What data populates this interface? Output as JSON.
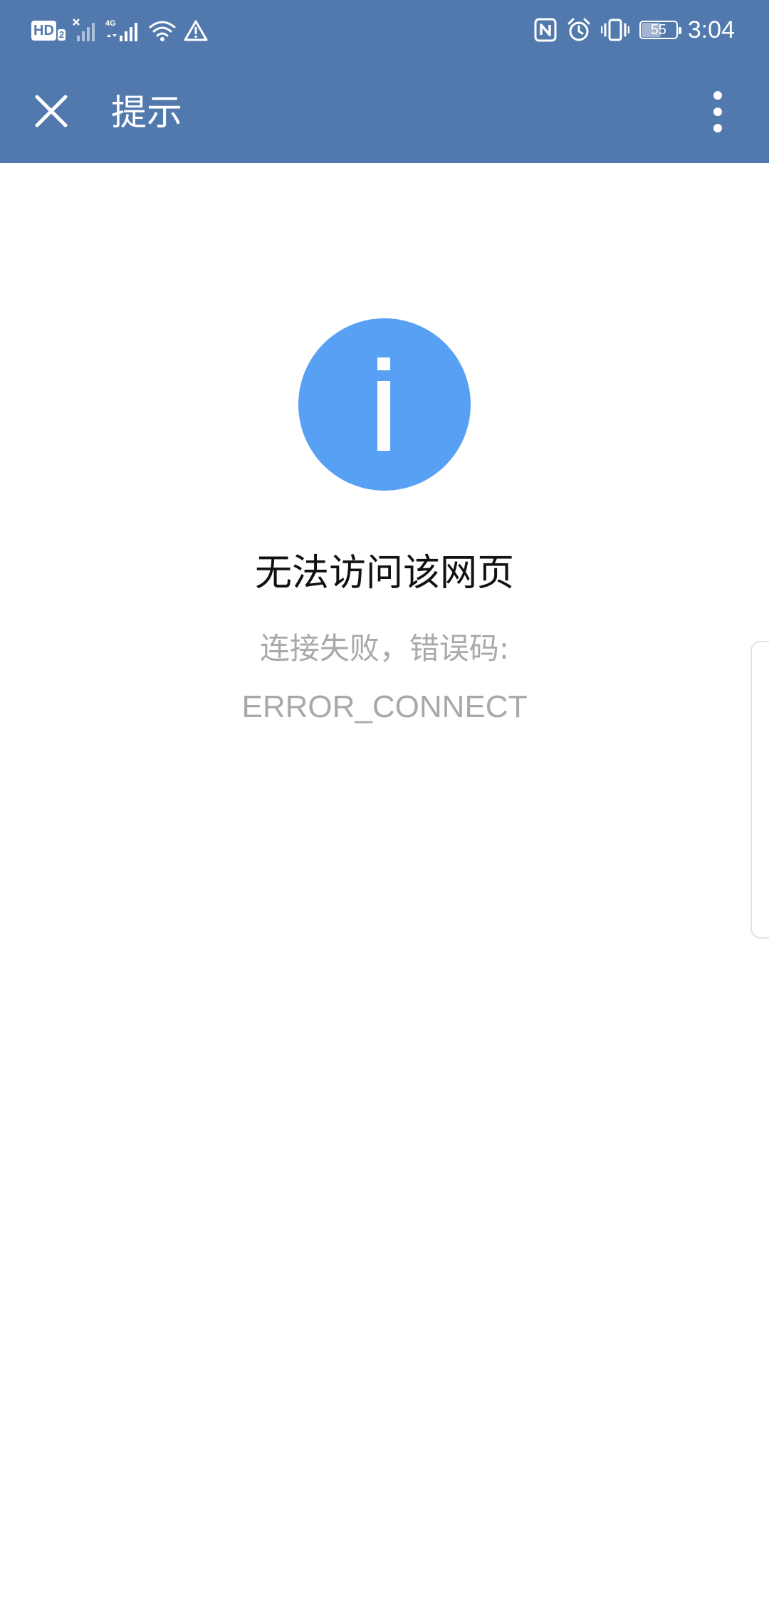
{
  "status_bar": {
    "hd_label": "HD",
    "hd_sub": "2",
    "network_label": "4G",
    "battery_level": "55",
    "time": "3:04",
    "left_icons": [
      "signal-no-service-icon",
      "signal-4g-icon",
      "wifi-icon",
      "warning-icon"
    ],
    "right_icons": [
      "nfc-icon",
      "alarm-icon",
      "vibrate-icon",
      "battery-icon"
    ]
  },
  "app_bar": {
    "title": "提示",
    "close_icon": "close-icon",
    "more_icon": "more-vert-icon"
  },
  "content": {
    "icon": "info-icon",
    "title": "无法访问该网页",
    "message_line1": "连接失败，错误码:",
    "message_line2": "ERROR_CONNECT"
  },
  "colors": {
    "header_bg": "#5179ad",
    "info_icon": "#57a0f4",
    "title_text": "#111111",
    "message_text": "#a9a9a9"
  }
}
